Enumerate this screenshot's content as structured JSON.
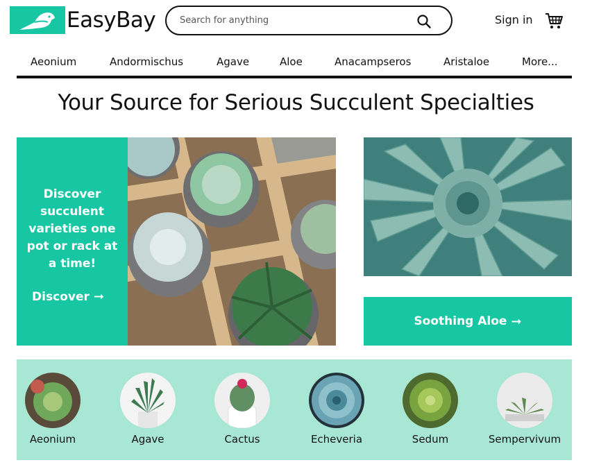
{
  "header": {
    "brand": "EasyBay",
    "search_placeholder": "Search for anything",
    "sign_in": "Sign in"
  },
  "nav": {
    "items": [
      "Aeonium",
      "Andormischus",
      "Agave",
      "Aloe",
      "Anacampseros",
      "Aristaloe",
      "More..."
    ]
  },
  "headline": "Your Source for Serious Succulent Specialties",
  "hero": {
    "promo_text": "Discover succulent varieties one pot or rack at a time!",
    "discover_label": "Discover",
    "aloe_label": "Soothing Aloe"
  },
  "categories": [
    "Aeonium",
    "Agave",
    "Cactus",
    "Echeveria",
    "Sedum",
    "Sempervivum"
  ],
  "colors": {
    "accent": "#17c7a3",
    "category_band": "#a7e7d4",
    "text": "#111111"
  },
  "icons": [
    "bird-logo-icon",
    "search-icon",
    "cart-icon",
    "arrow-right-icon"
  ]
}
